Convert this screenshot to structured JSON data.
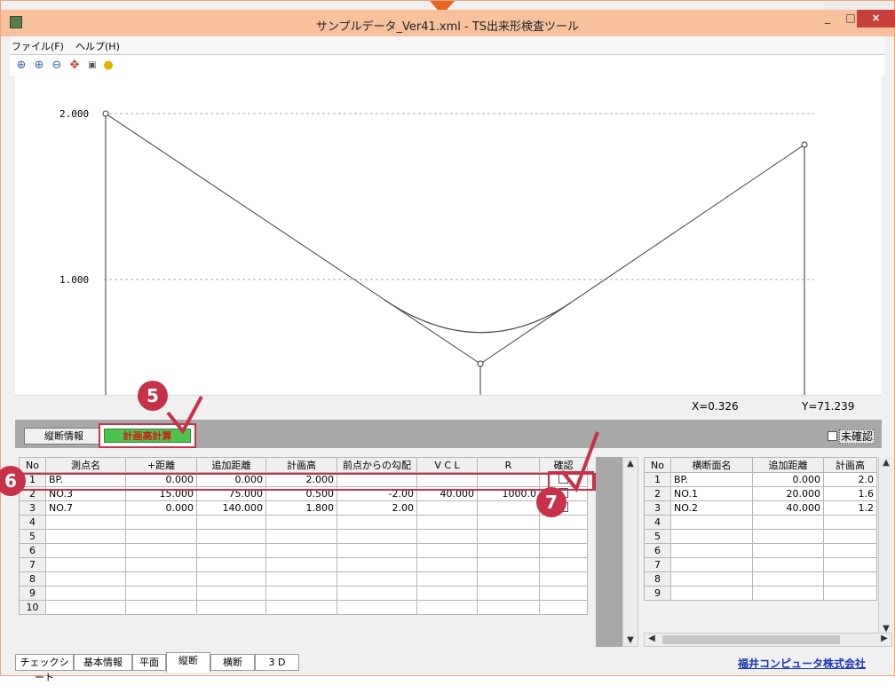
{
  "window": {
    "title": "サンプルデータ_Ver41.xml - TS出来形検査ツール",
    "min": "_",
    "max": "□",
    "close": "×"
  },
  "menu": [
    {
      "label": "ファイル(F)"
    },
    {
      "label": "ヘルプ(H)"
    }
  ],
  "toolbar": {
    "icons": [
      "zoom-fit-icon",
      "zoom-in-icon",
      "zoom-out-icon",
      "pan-icon",
      "fit-window-icon",
      "bulb-icon"
    ]
  },
  "plot": {
    "y_labels": [
      "2.000",
      "1.000"
    ]
  },
  "readout": {
    "x": "X=0.326",
    "y": "Y=71.239"
  },
  "tabs": {
    "info_label": "縦断情報",
    "calc_label": "計画高計算",
    "unconfirmed_label": "未確認"
  },
  "left_table": {
    "headers": [
      "No",
      "測点名",
      "+距離",
      "追加距離",
      "計画高",
      "前点からの勾配",
      "V C L",
      "R",
      "確認"
    ],
    "rows": [
      [
        "1",
        "BP.",
        "0.000",
        "0.000",
        "2.000",
        "",
        "",
        "",
        ""
      ],
      [
        "2",
        "NO.3",
        "15.000",
        "75.000",
        "0.500",
        "-2.00",
        "40.000",
        "1000.0",
        ""
      ],
      [
        "3",
        "NO.7",
        "0.000",
        "140.000",
        "1.800",
        "2.00",
        "",
        "",
        ""
      ],
      [
        "4",
        "",
        "",
        "",
        "",
        "",
        "",
        "",
        ""
      ],
      [
        "5",
        "",
        "",
        "",
        "",
        "",
        "",
        "",
        ""
      ],
      [
        "6",
        "",
        "",
        "",
        "",
        "",
        "",
        "",
        ""
      ],
      [
        "7",
        "",
        "",
        "",
        "",
        "",
        "",
        "",
        ""
      ],
      [
        "8",
        "",
        "",
        "",
        "",
        "",
        "",
        "",
        ""
      ],
      [
        "9",
        "",
        "",
        "",
        "",
        "",
        "",
        "",
        ""
      ],
      [
        "10",
        "",
        "",
        "",
        "",
        "",
        "",
        "",
        ""
      ]
    ]
  },
  "right_table": {
    "headers": [
      "No",
      "横断面名",
      "追加距離",
      "計画高"
    ],
    "rows": [
      [
        "1",
        "BP.",
        "0.000",
        "2.0"
      ],
      [
        "2",
        "NO.1",
        "20.000",
        "1.6"
      ],
      [
        "3",
        "NO.2",
        "40.000",
        "1.2"
      ],
      [
        "4",
        "",
        "",
        ""
      ],
      [
        "5",
        "",
        "",
        ""
      ],
      [
        "6",
        "",
        "",
        ""
      ],
      [
        "7",
        "",
        "",
        ""
      ],
      [
        "8",
        "",
        "",
        ""
      ],
      [
        "9",
        "",
        "",
        ""
      ]
    ]
  },
  "bottom_tabs": [
    "チェックシート",
    "基本情報",
    "平面",
    "縦断",
    "横断",
    "3 D"
  ],
  "company": "福井コンピュータ株式会社",
  "badges": [
    "5",
    "6",
    "7"
  ],
  "colors": {
    "accent": "#c7324a",
    "title_bar": "#f7c19d",
    "calc_button": "#4fc24f",
    "link": "#1a37b5"
  }
}
